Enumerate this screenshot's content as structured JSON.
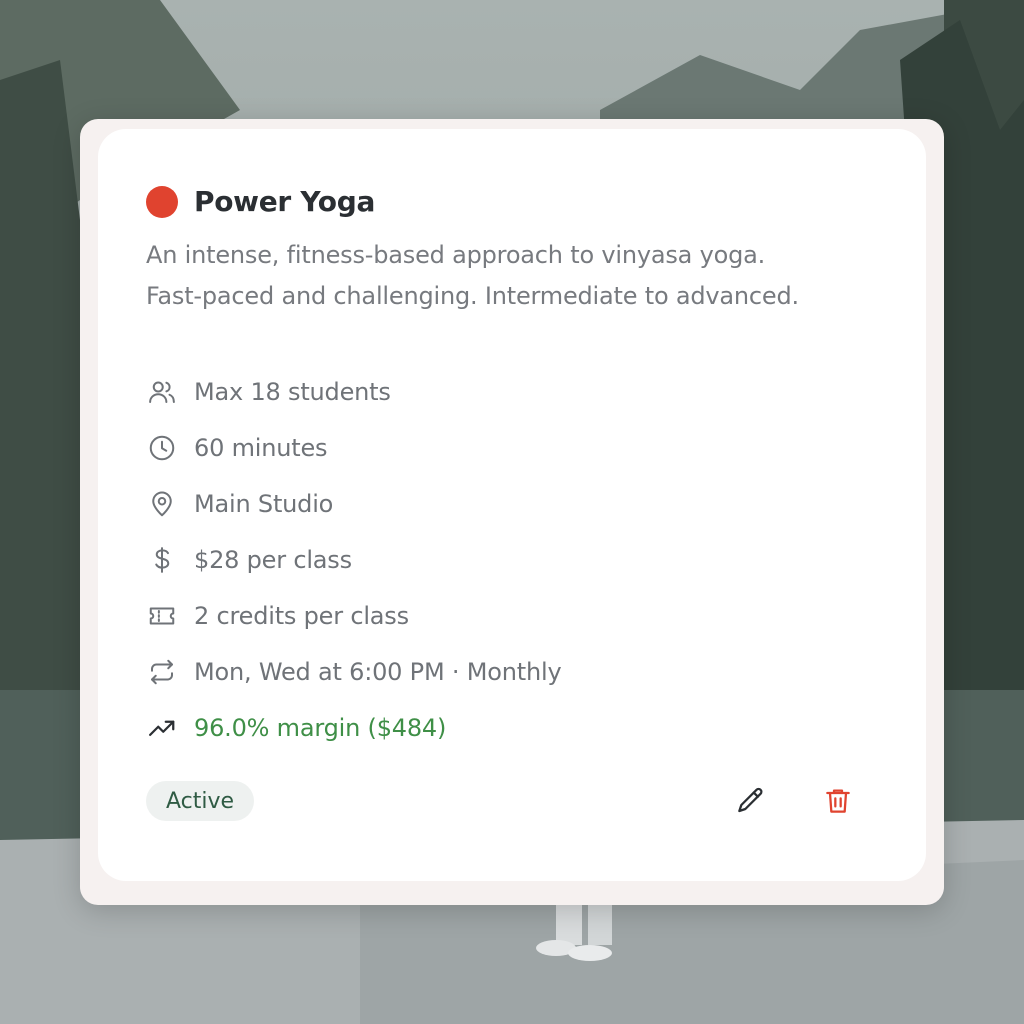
{
  "class_card": {
    "title": "Power Yoga",
    "color": "#e0432f",
    "description_lines": [
      "An intense, fitness-based approach to vinyasa yoga.",
      "Fast-paced and challenging. Intermediate to advanced."
    ],
    "details": [
      {
        "icon": "users-icon",
        "text": "Max 18 students"
      },
      {
        "icon": "clock-icon",
        "text": "60 minutes"
      },
      {
        "icon": "map-pin-icon",
        "text": "Main Studio"
      },
      {
        "icon": "dollar-icon",
        "text": "$28 per class"
      },
      {
        "icon": "ticket-icon",
        "text": "2 credits per class"
      },
      {
        "icon": "repeat-icon",
        "text": "Mon, Wed at 6:00 PM · Monthly"
      },
      {
        "icon": "trending-up-icon",
        "text": "96.0% margin ($484)",
        "color": "#3f8f47"
      }
    ],
    "status": "Active",
    "actions": [
      {
        "icon": "pencil-icon",
        "action": "edit"
      },
      {
        "icon": "trash-icon",
        "action": "delete",
        "color": "#e0432f"
      }
    ]
  }
}
